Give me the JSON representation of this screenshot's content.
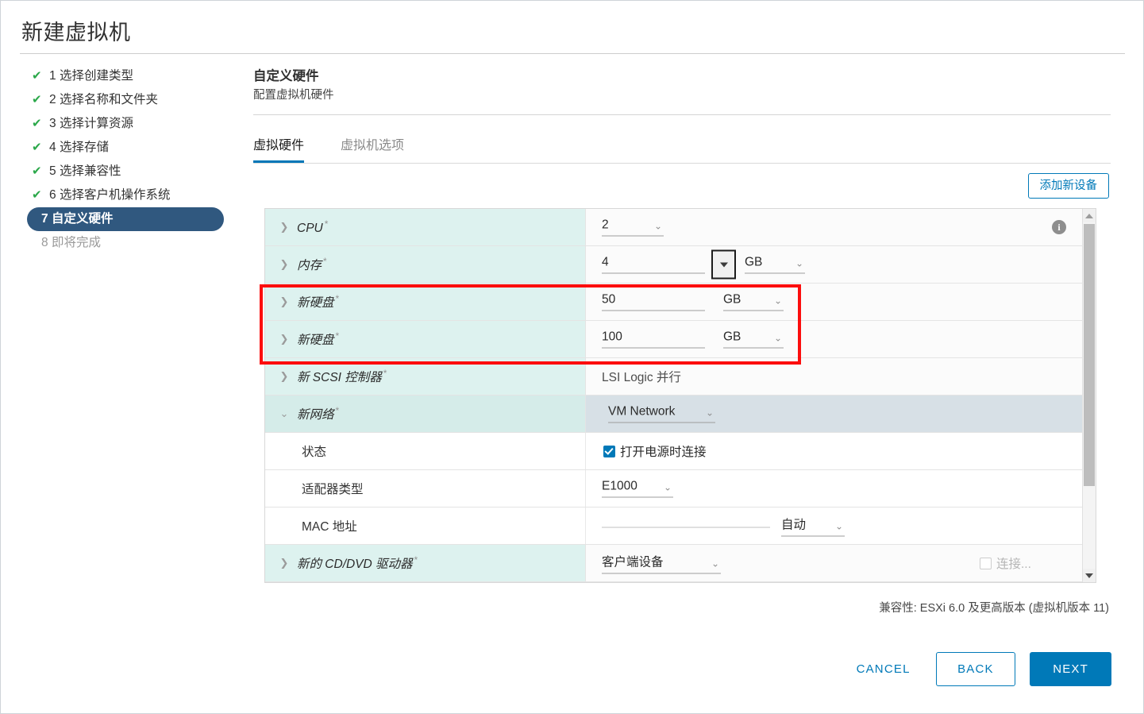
{
  "window": {
    "title": "新建虚拟机"
  },
  "steps": [
    {
      "num": "1",
      "label": "选择创建类型",
      "state": "done"
    },
    {
      "num": "2",
      "label": "选择名称和文件夹",
      "state": "done"
    },
    {
      "num": "3",
      "label": "选择计算资源",
      "state": "done"
    },
    {
      "num": "4",
      "label": "选择存储",
      "state": "done"
    },
    {
      "num": "5",
      "label": "选择兼容性",
      "state": "done"
    },
    {
      "num": "6",
      "label": "选择客户机操作系统",
      "state": "done"
    },
    {
      "num": "7",
      "label": "自定义硬件",
      "state": "active"
    },
    {
      "num": "8",
      "label": "即将完成",
      "state": "pending"
    }
  ],
  "check_glyph": "✔",
  "pane": {
    "title": "自定义硬件",
    "subtitle": "配置虚拟机硬件"
  },
  "tabs": [
    {
      "label": "虚拟硬件",
      "active": true
    },
    {
      "label": "虚拟机选项",
      "active": false
    }
  ],
  "toolbar": {
    "add_device_label": "添加新设备"
  },
  "hardware": {
    "cpu": {
      "name": "CPU",
      "required_mark": "*",
      "value": "2",
      "info_glyph": "i"
    },
    "memory": {
      "name": "内存",
      "required_mark": "*",
      "value": "4",
      "unit": "GB"
    },
    "disk1": {
      "name": "新硬盘",
      "required_mark": "*",
      "value": "50",
      "unit": "GB"
    },
    "disk2": {
      "name": "新硬盘",
      "required_mark": "*",
      "value": "100",
      "unit": "GB"
    },
    "scsi": {
      "name": "新 SCSI 控制器",
      "required_mark": "*",
      "value": "LSI Logic 并行"
    },
    "network": {
      "name": "新网络",
      "required_mark": "*",
      "value": "VM Network"
    },
    "status": {
      "name": "状态",
      "checkbox_label": "打开电源时连接",
      "checked": true
    },
    "adapter": {
      "name": "适配器类型",
      "value": "E1000"
    },
    "mac": {
      "name": "MAC 地址",
      "value": "",
      "mode": "自动"
    },
    "cddvd": {
      "name": "新的 CD/DVD 驱动器",
      "required_mark": "*",
      "value": "客户端设备",
      "checkbox_label": "连接...",
      "checked": false
    }
  },
  "footer": {
    "compatibility": "兼容性: ESXi 6.0 及更高版本 (虚拟机版本 11)",
    "cancel_label": "CANCEL",
    "back_label": "BACK",
    "next_label": "NEXT"
  },
  "icons": {
    "chevron_right": "❯",
    "chevron_down": "⌄",
    "chevron_small_down": "⌄"
  },
  "colors": {
    "accent": "#0079b8",
    "active_step": "#30587f",
    "check_green": "#2ba84a",
    "label_cell": "#ddf2ef",
    "annotation": "#fc0d0d"
  }
}
